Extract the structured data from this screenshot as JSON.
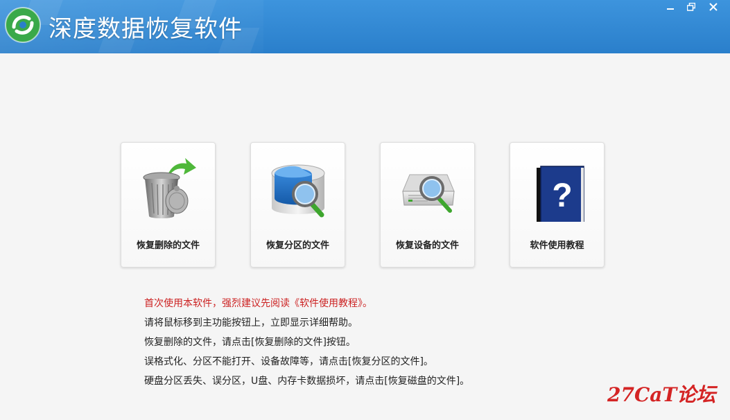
{
  "app": {
    "title": "深度数据恢复软件"
  },
  "window_controls": {
    "minimize": "minimize-icon",
    "restore": "restore-icon",
    "close": "close-icon"
  },
  "cards": [
    {
      "label": "恢复删除的文件",
      "icon": "recycle-bin-icon"
    },
    {
      "label": "恢复分区的文件",
      "icon": "disk-search-icon"
    },
    {
      "label": "恢复设备的文件",
      "icon": "device-search-icon"
    },
    {
      "label": "软件使用教程",
      "icon": "help-book-icon"
    }
  ],
  "help_lines": [
    "首次使用本软件，强烈建议先阅读《软件使用教程》。",
    "请将鼠标移到主功能按钮上，立即显示详细帮助。",
    "恢复删除的文件，请点击[恢复删除的文件]按钮。",
    "误格式化、分区不能打开、设备故障等，请点击[恢复分区的文件]。",
    "硬盘分区丢失、误分区，U盘、内存卡数据损坏，请点击[恢复磁盘的文件]。"
  ],
  "watermark": "27CaT论坛",
  "colors": {
    "titlebar": "#2f86d2",
    "warning_text": "#cc2222",
    "watermark": "#d42424"
  }
}
